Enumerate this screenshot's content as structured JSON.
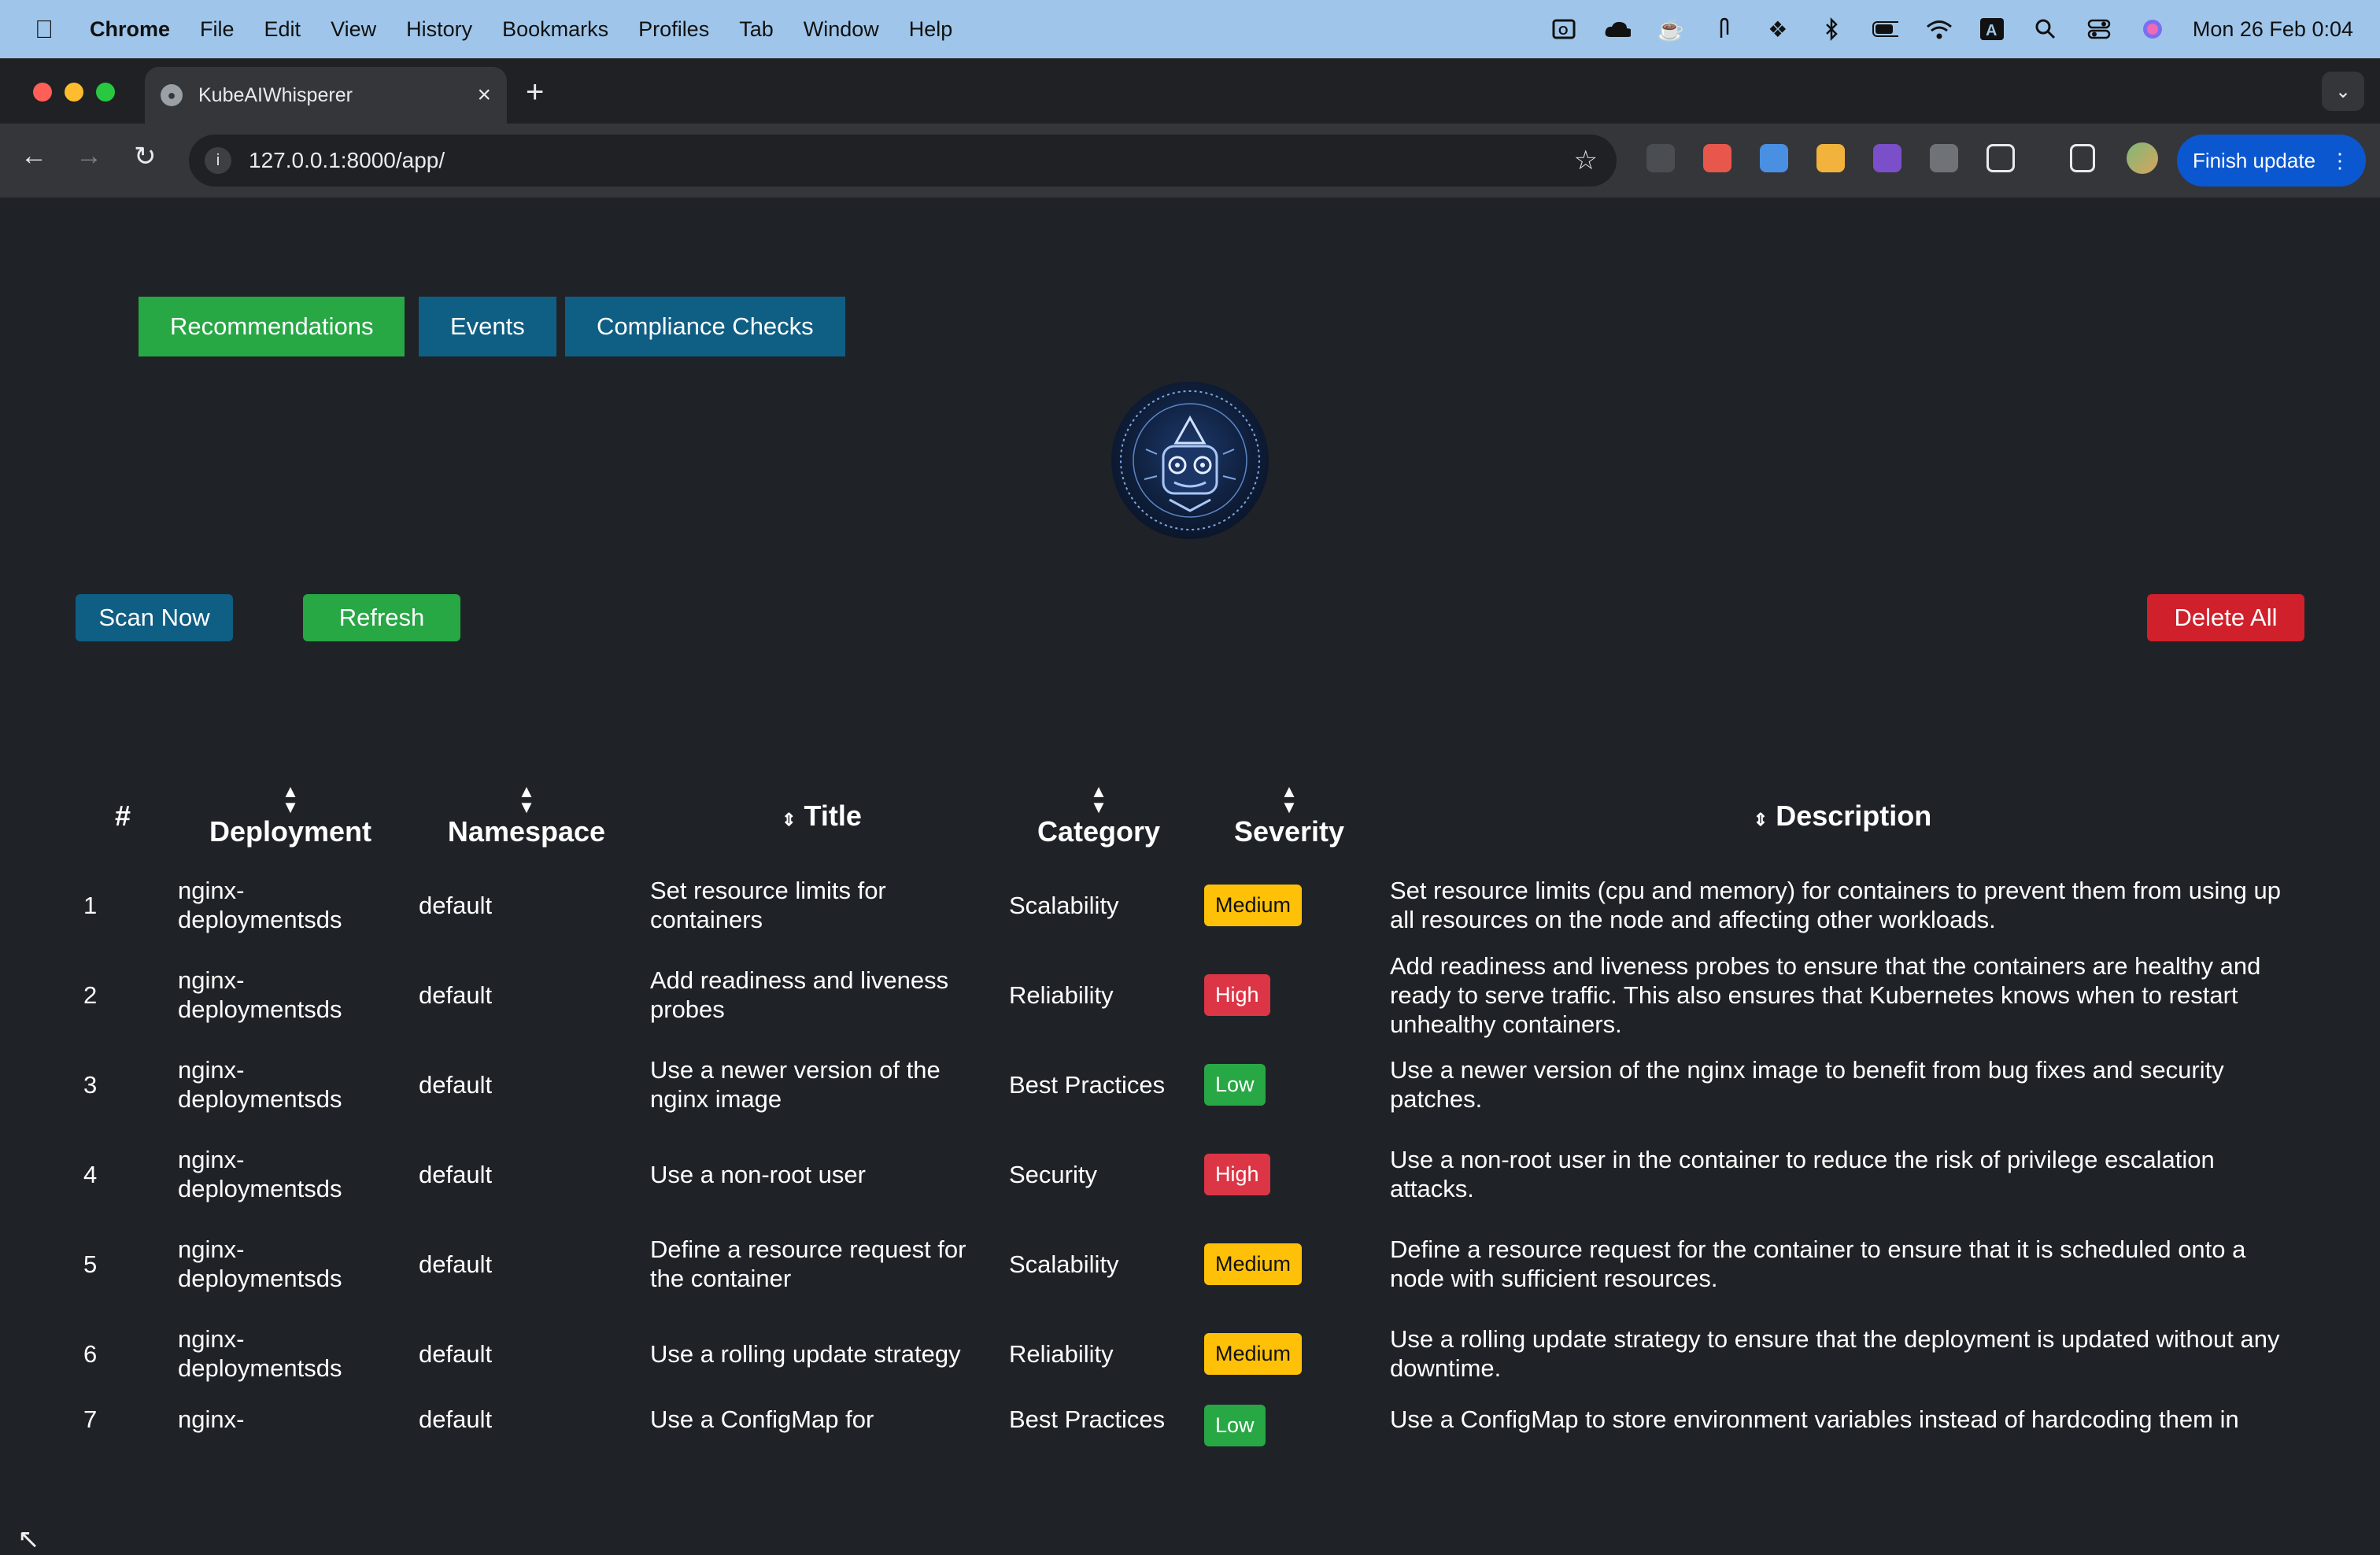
{
  "menubar": {
    "app_name": "Chrome",
    "items": [
      "File",
      "Edit",
      "View",
      "History",
      "Bookmarks",
      "Profiles",
      "Tab",
      "Window",
      "Help"
    ],
    "clock": "Mon 26 Feb  0:04",
    "status_icons": [
      "outlook-icon",
      "cloud-icon",
      "coffee-icon",
      "paperclip-icon",
      "dropbox-icon",
      "bluetooth-icon",
      "battery-icon",
      "wifi-icon",
      "keyboard-a-icon",
      "spotlight-icon",
      "control-center-icon",
      "siri-icon"
    ]
  },
  "browser": {
    "tab_title": "KubeAIWhisperer",
    "url": "127.0.0.1:8000/app/",
    "finish_update_label": "Finish update",
    "colors": {
      "update_button": "#0b57d0"
    }
  },
  "app": {
    "nav_tabs": [
      {
        "label": "Recommendations",
        "color": "#28a745",
        "active": true
      },
      {
        "label": "Events",
        "color": "#0f5e84",
        "active": false
      },
      {
        "label": "Compliance Checks",
        "color": "#0f5e84",
        "active": false
      }
    ],
    "actions": {
      "scan_label": "Scan Now",
      "refresh_label": "Refresh",
      "delete_label": "Delete All"
    },
    "colors": {
      "primary": "#0f5e84",
      "success": "#28a745",
      "danger": "#d0202b",
      "background": "#1f2327"
    },
    "table": {
      "headers": {
        "index": "#",
        "deployment": "Deployment",
        "namespace": "Namespace",
        "title": "Title",
        "category": "Category",
        "severity": "Severity",
        "description": "Description"
      },
      "severity_colors": {
        "Medium": "#ffc107",
        "High": "#dc3545",
        "Low": "#28a745"
      },
      "rows": [
        {
          "n": "1",
          "deployment": "nginx-deploymentsds",
          "namespace": "default",
          "title": "Set resource limits for containers",
          "category": "Scalability",
          "severity": "Medium",
          "description": "Set resource limits (cpu and memory) for containers to prevent them from using up all resources on the node and affecting other workloads."
        },
        {
          "n": "2",
          "deployment": "nginx-deploymentsds",
          "namespace": "default",
          "title": "Add readiness and liveness probes",
          "category": "Reliability",
          "severity": "High",
          "description": "Add readiness and liveness probes to ensure that the containers are healthy and ready to serve traffic. This also ensures that Kubernetes knows when to restart unhealthy containers."
        },
        {
          "n": "3",
          "deployment": "nginx-deploymentsds",
          "namespace": "default",
          "title": "Use a newer version of the nginx image",
          "category": "Best Practices",
          "severity": "Low",
          "description": "Use a newer version of the nginx image to benefit from bug fixes and security patches."
        },
        {
          "n": "4",
          "deployment": "nginx-deploymentsds",
          "namespace": "default",
          "title": "Use a non-root user",
          "category": "Security",
          "severity": "High",
          "description": "Use a non-root user in the container to reduce the risk of privilege escalation attacks."
        },
        {
          "n": "5",
          "deployment": "nginx-deploymentsds",
          "namespace": "default",
          "title": "Define a resource request for the container",
          "category": "Scalability",
          "severity": "Medium",
          "description": "Define a resource request for the container to ensure that it is scheduled onto a node with sufficient resources."
        },
        {
          "n": "6",
          "deployment": "nginx-deploymentsds",
          "namespace": "default",
          "title": "Use a rolling update strategy",
          "category": "Reliability",
          "severity": "Medium",
          "description": "Use a rolling update strategy to ensure that the deployment is updated without any downtime."
        },
        {
          "n": "7",
          "deployment": "nginx-",
          "namespace": "default",
          "title": "Use a ConfigMap for",
          "category": "Best Practices",
          "severity": "Low",
          "description": "Use a ConfigMap to store environment variables instead of hardcoding them in"
        }
      ]
    }
  }
}
